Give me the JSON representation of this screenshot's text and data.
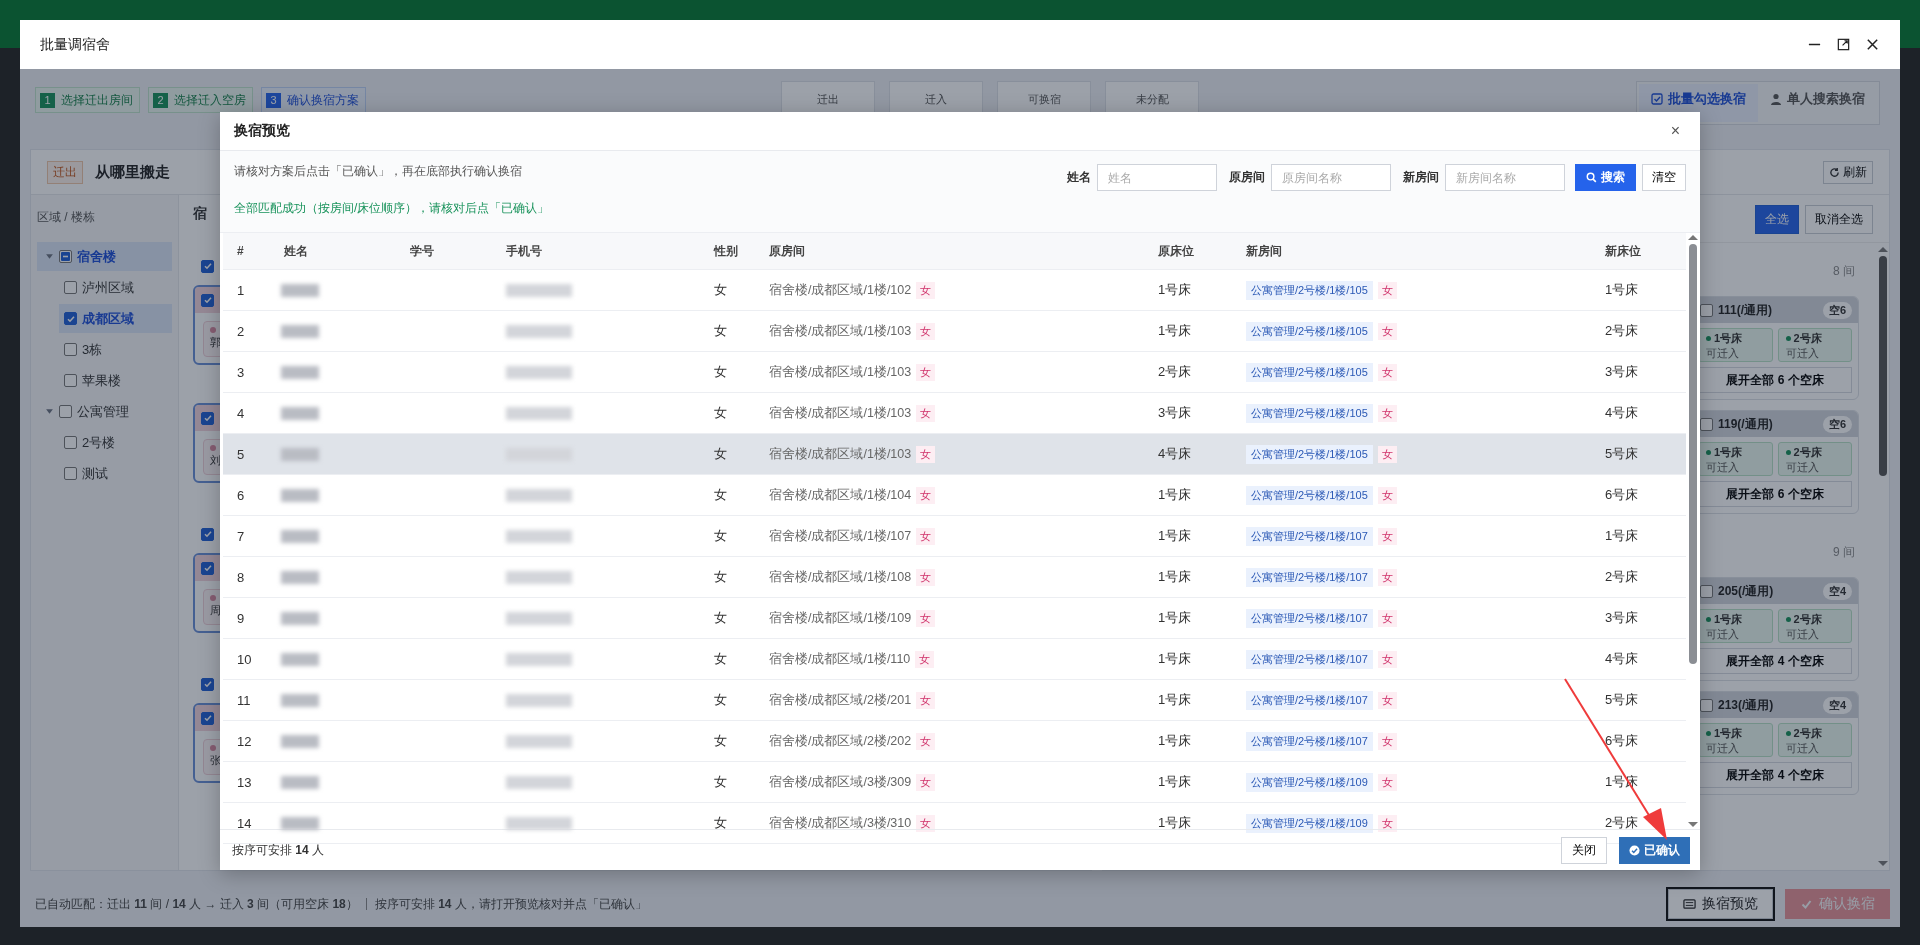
{
  "window": {
    "title": "批量调宿舍"
  },
  "steps": [
    {
      "number": "1",
      "label": "选择迁出房间",
      "selected": false
    },
    {
      "number": "2",
      "label": "选择迁入空房",
      "selected": false
    },
    {
      "number": "3",
      "label": "确认换宿方案",
      "selected": true
    }
  ],
  "stats": [
    {
      "label": "迁出"
    },
    {
      "label": "迁入"
    },
    {
      "label": "可换宿"
    },
    {
      "label": "未分配"
    }
  ],
  "mode_tabs": [
    {
      "label": "批量勾选换宿",
      "selected": true
    },
    {
      "label": "单人搜索换宿",
      "selected": false
    }
  ],
  "source_panel": {
    "tag": "迁出",
    "title": "从哪里搬走",
    "tree_heading": "区域 / 楼栋",
    "tree": [
      {
        "label": "宿舍楼",
        "checked": false,
        "indeterminate": true,
        "selected": true,
        "expanded": true,
        "children": [
          {
            "label": "泸州区域",
            "checked": false,
            "indeterminate": false,
            "selected": false
          },
          {
            "label": "成都区域",
            "checked": true,
            "indeterminate": false,
            "selected": true
          },
          {
            "label": "3栋",
            "checked": false,
            "indeterminate": false,
            "selected": false
          },
          {
            "label": "苹果楼",
            "checked": false,
            "indeterminate": false,
            "selected": false
          }
        ]
      },
      {
        "label": "公寓管理",
        "checked": false,
        "indeterminate": false,
        "selected": false,
        "expanded": true,
        "children": [
          {
            "label": "2号楼",
            "checked": false,
            "indeterminate": false,
            "selected": false
          },
          {
            "label": "测试",
            "checked": false,
            "indeterminate": false,
            "selected": false
          }
        ]
      }
    ],
    "list_heading": "宿",
    "groups": [
      {
        "checked": true,
        "rooms": [
          {
            "checked": true,
            "occupant": "郭"
          },
          {
            "checked": true,
            "occupant": "刘"
          }
        ]
      },
      {
        "checked": true,
        "rooms": [
          {
            "checked": true,
            "occupant": "周"
          }
        ]
      },
      {
        "checked": true,
        "rooms": [
          {
            "checked": true,
            "occupant": "张"
          }
        ]
      }
    ]
  },
  "target_panel": {
    "refresh": "刷新",
    "select_all": "全选",
    "deselect_all": "取消全选",
    "groups": [
      {
        "count": "8 间",
        "rooms": [
          {
            "name": "111(/通用)",
            "badge": "空6",
            "checked": false,
            "beds": [
              {
                "name": "1号床",
                "status": "可迁入"
              },
              {
                "name": "2号床",
                "status": "可迁入"
              }
            ],
            "expand": "展开全部 6 个空床"
          },
          {
            "name": "119(/通用)",
            "badge": "空6",
            "checked": false,
            "beds": [
              {
                "name": "1号床",
                "status": "可迁入"
              },
              {
                "name": "2号床",
                "status": "可迁入"
              }
            ],
            "expand": "展开全部 6 个空床"
          }
        ]
      },
      {
        "count": "9 间",
        "rooms": [
          {
            "name": "205(/通用)",
            "badge": "空4",
            "checked": false,
            "beds": [
              {
                "name": "1号床",
                "status": "可迁入"
              },
              {
                "name": "2号床",
                "status": "可迁入"
              }
            ],
            "expand": "展开全部 4 个空床"
          },
          {
            "name": "213(/通用)",
            "badge": "空4",
            "checked": false,
            "beds": [
              {
                "name": "1号床",
                "status": "可迁入"
              },
              {
                "name": "2号床",
                "status": "可迁入"
              }
            ],
            "expand": "展开全部 4 个空床"
          }
        ]
      }
    ]
  },
  "status_bar": {
    "summary": "已自动匹配：迁出 **11** 间 / **14** 人 → 迁入 **3** 间（可用空床 **18**）",
    "hint": "按序可安排 **14** 人，请打开预览核对并点「已确认」",
    "buttons": [
      {
        "label": "换宿预览",
        "kind": "preview",
        "disabled": false,
        "focused": true
      },
      {
        "label": "确认换宿",
        "kind": "confirm",
        "disabled": true,
        "focused": false
      }
    ]
  },
  "preview_dialog": {
    "title": "换宿预览",
    "close": "×",
    "notice": "请核对方案后点击「已确认」，再在底部执行确认换宿",
    "success": "全部匹配成功（按房间/床位顺序），请核对后点「已确认」",
    "filters": [
      {
        "label": "姓名",
        "placeholder": "姓名"
      },
      {
        "label": "原房间",
        "placeholder": "原房间名称"
      },
      {
        "label": "新房间",
        "placeholder": "新房间名称"
      }
    ],
    "search_button": "搜索",
    "clear_button": "清空",
    "columns": [
      "#",
      "姓名",
      "学号",
      "手机号",
      "性别",
      "原房间",
      "原床位",
      "新房间",
      "新床位"
    ],
    "rows": [
      {
        "index": "1",
        "gender": "女",
        "from_room": "宿舍楼/成都区域/1楼/102",
        "from_tag": "女",
        "from_bed": "1号床",
        "to_room": "公寓管理/2号楼/1楼/105",
        "to_tag": "女",
        "to_bed": "1号床",
        "hovered": false
      },
      {
        "index": "2",
        "gender": "女",
        "from_room": "宿舍楼/成都区域/1楼/103",
        "from_tag": "女",
        "from_bed": "1号床",
        "to_room": "公寓管理/2号楼/1楼/105",
        "to_tag": "女",
        "to_bed": "2号床",
        "hovered": false
      },
      {
        "index": "3",
        "gender": "女",
        "from_room": "宿舍楼/成都区域/1楼/103",
        "from_tag": "女",
        "from_bed": "2号床",
        "to_room": "公寓管理/2号楼/1楼/105",
        "to_tag": "女",
        "to_bed": "3号床",
        "hovered": false
      },
      {
        "index": "4",
        "gender": "女",
        "from_room": "宿舍楼/成都区域/1楼/103",
        "from_tag": "女",
        "from_bed": "3号床",
        "to_room": "公寓管理/2号楼/1楼/105",
        "to_tag": "女",
        "to_bed": "4号床",
        "hovered": false
      },
      {
        "index": "5",
        "gender": "女",
        "from_room": "宿舍楼/成都区域/1楼/103",
        "from_tag": "女",
        "from_bed": "4号床",
        "to_room": "公寓管理/2号楼/1楼/105",
        "to_tag": "女",
        "to_bed": "5号床",
        "hovered": true
      },
      {
        "index": "6",
        "gender": "女",
        "from_room": "宿舍楼/成都区域/1楼/104",
        "from_tag": "女",
        "from_bed": "1号床",
        "to_room": "公寓管理/2号楼/1楼/105",
        "to_tag": "女",
        "to_bed": "6号床",
        "hovered": false
      },
      {
        "index": "7",
        "gender": "女",
        "from_room": "宿舍楼/成都区域/1楼/107",
        "from_tag": "女",
        "from_bed": "1号床",
        "to_room": "公寓管理/2号楼/1楼/107",
        "to_tag": "女",
        "to_bed": "1号床",
        "hovered": false
      },
      {
        "index": "8",
        "gender": "女",
        "from_room": "宿舍楼/成都区域/1楼/108",
        "from_tag": "女",
        "from_bed": "1号床",
        "to_room": "公寓管理/2号楼/1楼/107",
        "to_tag": "女",
        "to_bed": "2号床",
        "hovered": false
      },
      {
        "index": "9",
        "gender": "女",
        "from_room": "宿舍楼/成都区域/1楼/109",
        "from_tag": "女",
        "from_bed": "1号床",
        "to_room": "公寓管理/2号楼/1楼/107",
        "to_tag": "女",
        "to_bed": "3号床",
        "hovered": false
      },
      {
        "index": "10",
        "gender": "女",
        "from_room": "宿舍楼/成都区域/1楼/110",
        "from_tag": "女",
        "from_bed": "1号床",
        "to_room": "公寓管理/2号楼/1楼/107",
        "to_tag": "女",
        "to_bed": "4号床",
        "hovered": false
      },
      {
        "index": "11",
        "gender": "女",
        "from_room": "宿舍楼/成都区域/2楼/201",
        "from_tag": "女",
        "from_bed": "1号床",
        "to_room": "公寓管理/2号楼/1楼/107",
        "to_tag": "女",
        "to_bed": "5号床",
        "hovered": false
      },
      {
        "index": "12",
        "gender": "女",
        "from_room": "宿舍楼/成都区域/2楼/202",
        "from_tag": "女",
        "from_bed": "1号床",
        "to_room": "公寓管理/2号楼/1楼/107",
        "to_tag": "女",
        "to_bed": "6号床",
        "hovered": false
      },
      {
        "index": "13",
        "gender": "女",
        "from_room": "宿舍楼/成都区域/3楼/309",
        "from_tag": "女",
        "from_bed": "1号床",
        "to_room": "公寓管理/2号楼/1楼/109",
        "to_tag": "女",
        "to_bed": "1号床",
        "hovered": false
      },
      {
        "index": "14",
        "gender": "女",
        "from_room": "宿舍楼/成都区域/3楼/310",
        "from_tag": "女",
        "from_bed": "1号床",
        "to_room": "公寓管理/2号楼/1楼/109",
        "to_tag": "女",
        "to_bed": "2号床",
        "hovered": false
      }
    ],
    "footer": "按序可安排 **14** 人",
    "buttons": [
      {
        "label": "关闭",
        "kind": "close"
      },
      {
        "label": "已确认",
        "kind": "confirm"
      }
    ]
  }
}
